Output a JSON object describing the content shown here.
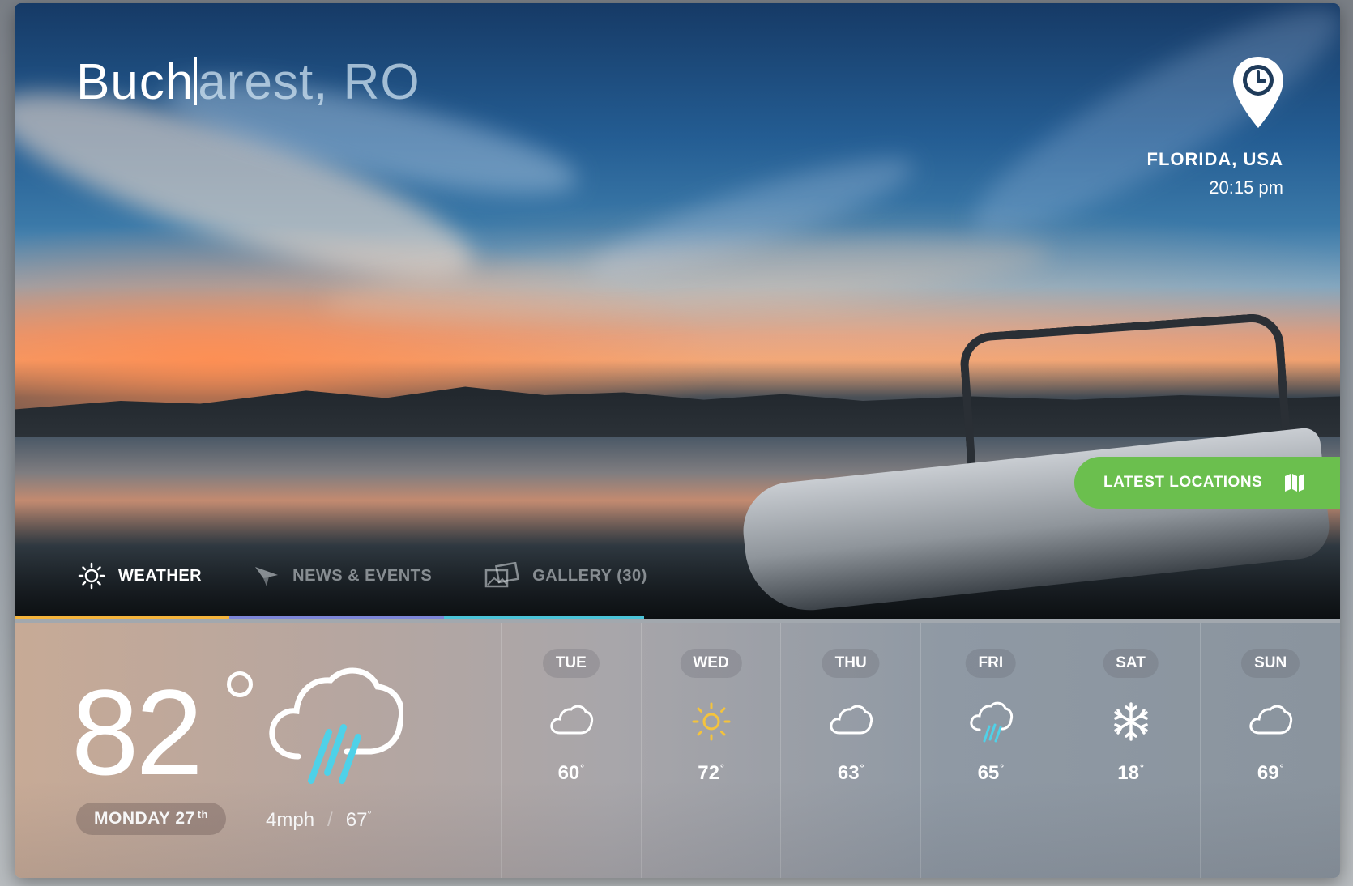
{
  "search": {
    "typed": "Buch",
    "suggestion": "arest, RO"
  },
  "location": {
    "name": "FLORIDA, USA",
    "time": "20:15 pm",
    "icon": "location-clock-pin-icon"
  },
  "latest_button": {
    "label": "LATEST LOCATIONS",
    "icon": "map-icon",
    "color": "#6bbf4e"
  },
  "nav": {
    "items": [
      {
        "label": "WEATHER",
        "icon": "sun-icon",
        "active": true
      },
      {
        "label": "NEWS & EVENTS",
        "icon": "paper-plane-icon",
        "active": false
      },
      {
        "label": "GALLERY (30)",
        "icon": "gallery-icon",
        "active": false
      }
    ],
    "bar_colors": [
      "#f4b43c",
      "#7d86d8",
      "#4cc4d8"
    ]
  },
  "current": {
    "temp": "82",
    "date_label": "MONDAY 27",
    "date_suffix": "th",
    "icon": "cloud-rain-icon",
    "wind": "4mph",
    "separator": "/",
    "low": "67"
  },
  "forecast": [
    {
      "day": "TUE",
      "icon": "cloud-icon",
      "temp": "60"
    },
    {
      "day": "WED",
      "icon": "sun-icon",
      "temp": "72"
    },
    {
      "day": "THU",
      "icon": "cloud-icon",
      "temp": "63"
    },
    {
      "day": "FRI",
      "icon": "cloud-rain-icon",
      "temp": "65"
    },
    {
      "day": "SAT",
      "icon": "snowflake-icon",
      "temp": "18"
    },
    {
      "day": "SUN",
      "icon": "cloud-icon",
      "temp": "69"
    }
  ],
  "degree_symbol": "°"
}
